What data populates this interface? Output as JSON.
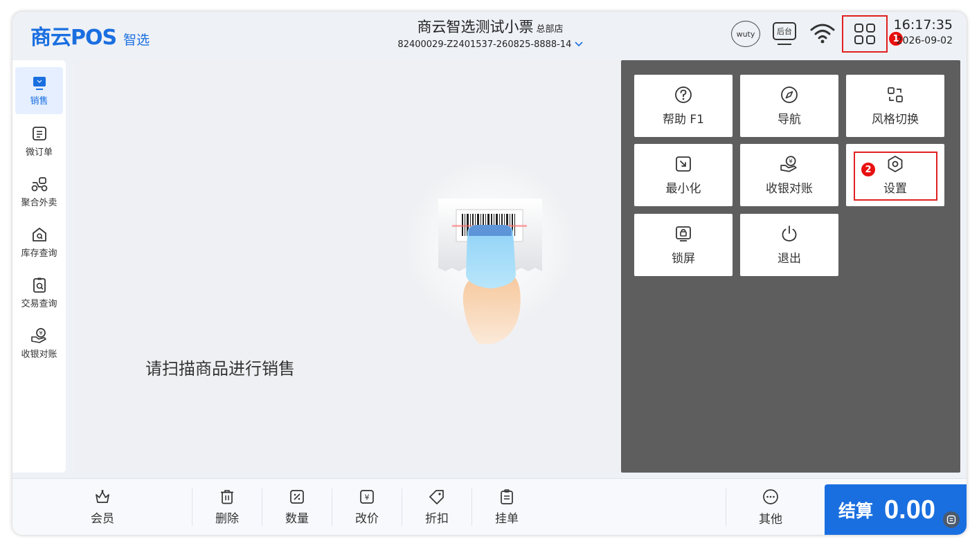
{
  "header": {
    "logo_main": "商云POS",
    "logo_sub": "智选",
    "store_title": "商云智选测试小票",
    "store_badge": "总部店",
    "store_id": "82400029-Z2401537-260825-8888-14",
    "user_label": "wuty",
    "backend_label": "后台",
    "time": "16:17:35",
    "date": "2026-09-02",
    "step1": "1"
  },
  "sidebar": {
    "items": [
      {
        "label": "销售",
        "icon": "sales-monitor-icon"
      },
      {
        "label": "微订单",
        "icon": "micro-order-icon"
      },
      {
        "label": "聚合外卖",
        "icon": "delivery-icon"
      },
      {
        "label": "库存查询",
        "icon": "inventory-search-icon"
      },
      {
        "label": "交易查询",
        "icon": "transaction-search-icon"
      },
      {
        "label": "收银对账",
        "icon": "cashier-reconcile-icon"
      }
    ]
  },
  "main": {
    "scan_hint": "请扫描商品进行销售"
  },
  "panel": {
    "tiles": [
      {
        "label": "帮助 F1",
        "icon": "help-icon"
      },
      {
        "label": "导航",
        "icon": "compass-icon"
      },
      {
        "label": "风格切换",
        "icon": "style-switch-icon"
      },
      {
        "label": "最小化",
        "icon": "minimize-icon"
      },
      {
        "label": "收银对账",
        "icon": "cashier-reconcile-icon"
      },
      {
        "label": "设置",
        "icon": "settings-icon"
      },
      {
        "label": "锁屏",
        "icon": "lock-screen-icon"
      },
      {
        "label": "退出",
        "icon": "power-icon"
      }
    ],
    "step2": "2"
  },
  "bottom": {
    "member": "会员",
    "delete": "删除",
    "quantity": "数量",
    "price": "改价",
    "discount": "折扣",
    "hold": "挂单",
    "other": "其他",
    "checkout_label": "结算",
    "checkout_amount": "0.00"
  },
  "colors": {
    "brand": "#1a6fe0",
    "highlight": "#e02020",
    "panel_bg": "#5e5e5e"
  }
}
